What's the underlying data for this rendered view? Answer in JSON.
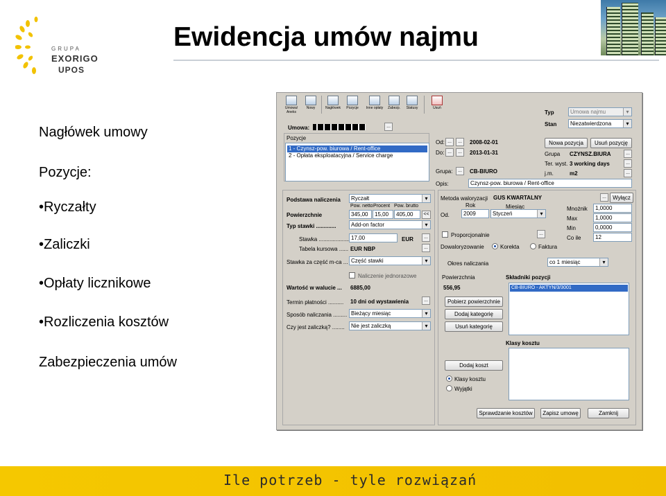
{
  "slide": {
    "title": "Ewidencja umów najmu",
    "logo": {
      "grupa": "GRUPA",
      "main": "EXORIGO",
      "sub": "UPOS"
    },
    "bullets": [
      "Nagłówek umowy",
      "Pozycje:",
      "•Ryczałty",
      "•Zaliczki",
      "•Opłaty licznikowe",
      "•Rozliczenia kosztów",
      "Zabezpieczenia umów"
    ],
    "footer": "Ile potrzeb - tyle rozwiązań"
  },
  "toolbar": {
    "buttons": [
      {
        "label": "Umowa/ Aneks",
        "icon": "contract-icon"
      },
      {
        "label": "Nowy",
        "icon": "new-document-icon"
      },
      {
        "label": "Nagłówek",
        "icon": "header-icon"
      },
      {
        "label": "Pozycje",
        "icon": "items-icon"
      },
      {
        "label": "Inne opłaty",
        "icon": "other-fees-icon"
      },
      {
        "label": "Zabezp.",
        "icon": "security-icon"
      },
      {
        "label": "Statusy",
        "icon": "statuses-icon"
      },
      {
        "label": "Usuń",
        "icon": "delete-icon"
      }
    ]
  },
  "header": {
    "typ_label": "Typ",
    "typ_value": "Umowa najmu",
    "stan_label": "Stan",
    "stan_value": "Niezatwierdzona",
    "umowa_label": "Umowa:",
    "umowa_dots": "..."
  },
  "pozycje": {
    "group_label": "Pozycje",
    "items": [
      "1  - Czynsz-pow. biurowa / Rent-office",
      "2  - Opłata eksploatacyjna / Service charge"
    ],
    "od_label": "Od:",
    "od_value": "2008-02-01",
    "do_label": "Do:",
    "do_value": "2013-01-31",
    "grupa_label": "Grupa:",
    "grupa_value": "CB-BIURO",
    "opis_label": "Opis:",
    "opis_value": "Czynsz-pow. biurowa / Rent-office",
    "nowa_btn": "Nowa pozycja",
    "usun_btn": "Usuń pozycję",
    "grupa2_label": "Grupa",
    "grupa2_value": "CZYNSZ.BIURA",
    "ter_label": "Ter. wyst.",
    "ter_value": "3 working days",
    "jm_label": "j.m.",
    "jm_value": "m2"
  },
  "left": {
    "podstawa_label": "Podstawa naliczenia",
    "podstawa_value": "Ryczałt",
    "col_netto": "Pow. netto",
    "col_procent": "Procent",
    "col_brutto": "Pow. brutto",
    "pow_label": "Powierzchnie",
    "pow_netto": "345,00",
    "pow_procent": "15,00",
    "pow_brutto": "405,00",
    "pow_btn": "<<",
    "typ_stawki_label": "Typ stawki .............",
    "typ_stawki_value": "Add-on factor",
    "stawka_label": "Stawka ....................",
    "stawka_value": "17,00",
    "stawka_cur": "EUR",
    "tabela_label": "Tabela kursowa ......",
    "tabela_value": "EUR NBP",
    "stawka_czesc_label": "Stawka za część m-ca ...",
    "stawka_czesc_value": "Część stawki",
    "naliczenie_label": "Naliczenie jednorazowe",
    "wartosc_label": "Wartość w walucie ...",
    "wartosc_value": "6885,00",
    "termin_label": "Termin płatności ..........",
    "termin_value": "10 dni od wystawienia",
    "sposob_label": "Sposób naliczania .........",
    "sposob_value": "Bieżący miesiąc",
    "czy_label": "Czy jest zaliczką? ........",
    "czy_value": "Nie jest zaliczką"
  },
  "right": {
    "metoda_label": "Metoda waloryzacji",
    "metoda_value": "GUS KWARTALNY",
    "wylacz_btn": "Wyłącz",
    "rok_label": "Rok",
    "miesiac_label": "Miesiąc",
    "od_label": "Od.",
    "rok_value": "2009",
    "miesiac_value": "Styczeń",
    "mnoznik_label": "Mnożnik",
    "mnoznik_value": "1,0000",
    "max_label": "Max",
    "max_value": "1,0000",
    "min_label": "Min",
    "min_value": "0,0000",
    "cole_label": "Co ile",
    "cole_value": "12",
    "proporcjonalnie_label": "Proporcjonalnie",
    "dowaloryzowanie_label": "Dowaloryzowanie",
    "korekta_label": "Korekta",
    "faktura_label": "Faktura",
    "okres_label": "Okres naliczania",
    "okres_value": "co 1 miesiąc",
    "powierzchnia_label": "Powierzchnia",
    "powierzchnia_value": "556,95",
    "skladniki_label": "Składniki pozycji",
    "skladniki_items": [
      "CB-BIURO - AKTYN/3/3001"
    ],
    "pobierz_btn": "Pobierz powierzchnie",
    "dodaj_kat_btn": "Dodaj kategorię",
    "usun_kat_btn": "Usuń kategorię",
    "klasy_label": "Klasy kosztu",
    "dodaj_koszt_btn": "Dodaj koszt",
    "klasy_radio": "Klasy kosztu",
    "wyjatki_radio": "Wyjątki"
  },
  "bottom": {
    "sprawdzanie_btn": "Sprawdzanie kosztów",
    "zapisz_btn": "Zapisz umowę",
    "zamknij_btn": "Zamknij"
  }
}
